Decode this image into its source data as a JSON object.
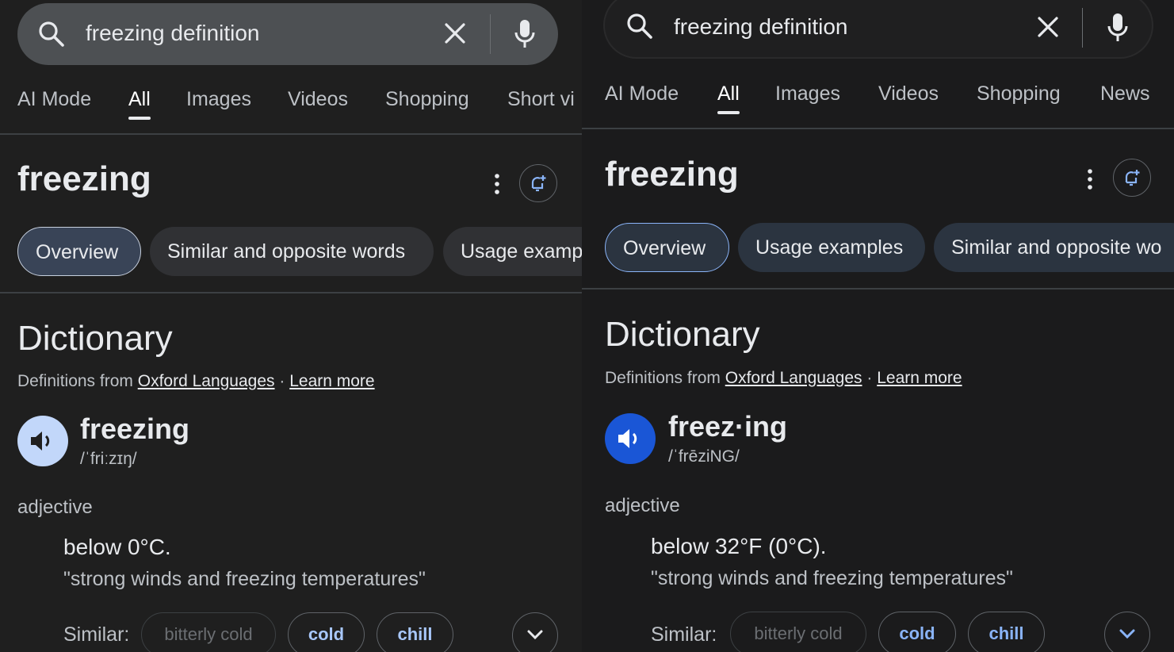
{
  "left": {
    "search": {
      "query": "freezing definition"
    },
    "tabs": [
      "AI Mode",
      "All",
      "Images",
      "Videos",
      "Shopping",
      "Short vi"
    ],
    "title": "freezing",
    "chips": [
      "Overview",
      "Similar and opposite words",
      "Usage examp"
    ],
    "dictionary": {
      "heading": "Dictionary",
      "source_prefix": "Definitions from",
      "source_link": "Oxford Languages",
      "separator": "·",
      "learn_more": "Learn more",
      "word": "freezing",
      "phonetic": "/ˈfriːzɪŋ/",
      "pos": "adjective",
      "definition": "below 0°C.",
      "example": "\"strong winds and freezing temperatures\"",
      "similar_label": "Similar:",
      "similar": [
        "bitterly cold",
        "cold",
        "chill"
      ]
    }
  },
  "right": {
    "search": {
      "query": "freezing definition"
    },
    "tabs": [
      "AI Mode",
      "All",
      "Images",
      "Videos",
      "Shopping",
      "News"
    ],
    "title": "freezing",
    "chips": [
      "Overview",
      "Usage examples",
      "Similar and opposite wo"
    ],
    "dictionary": {
      "heading": "Dictionary",
      "source_prefix": "Definitions from",
      "source_link": "Oxford Languages",
      "separator": "·",
      "learn_more": "Learn more",
      "word": "freez·ing",
      "phonetic": "/ˈfrēziNG/",
      "pos": "adjective",
      "definition": "below 32°F (0°C).",
      "example": "\"strong winds and freezing temperatures\"",
      "similar_label": "Similar:",
      "similar": [
        "bitterly cold",
        "cold",
        "chill"
      ]
    }
  },
  "colors": {
    "background": "#1f1f1f",
    "text": "#e8eaed",
    "muted": "#bdc1c6",
    "speaker_left": "#c2d7fa",
    "speaker_right": "#1a56d6",
    "link_blue": "#8ab4f8"
  }
}
